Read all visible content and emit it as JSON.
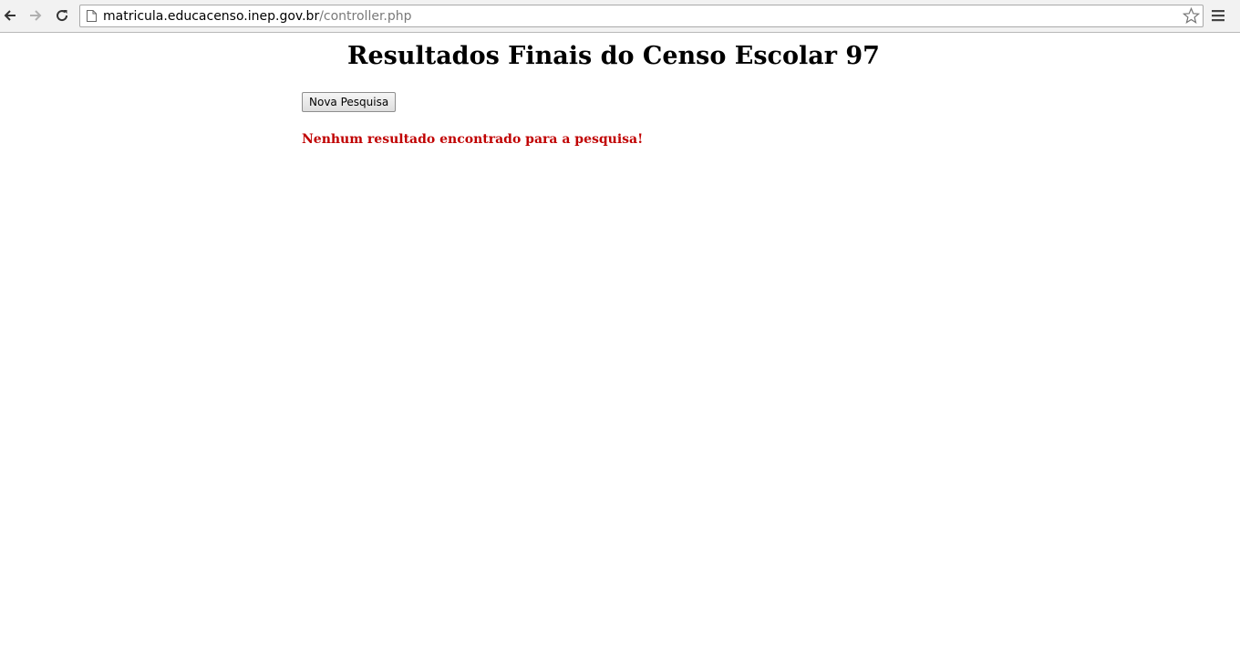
{
  "browser": {
    "url_host": "matricula.educacenso.inep.gov.br",
    "url_path": "/controller.php",
    "icons": {
      "back": "back-arrow-icon",
      "forward": "forward-arrow-icon",
      "reload": "reload-icon",
      "page": "page-icon",
      "bookmark": "star-icon",
      "menu": "hamburger-menu-icon"
    }
  },
  "page": {
    "title": "Resultados Finais do Censo Escolar 97",
    "new_search_label": "Nova Pesquisa",
    "no_result_message": "Nenhum resultado encontrado para a pesquisa!",
    "message_color": "#c00000"
  }
}
